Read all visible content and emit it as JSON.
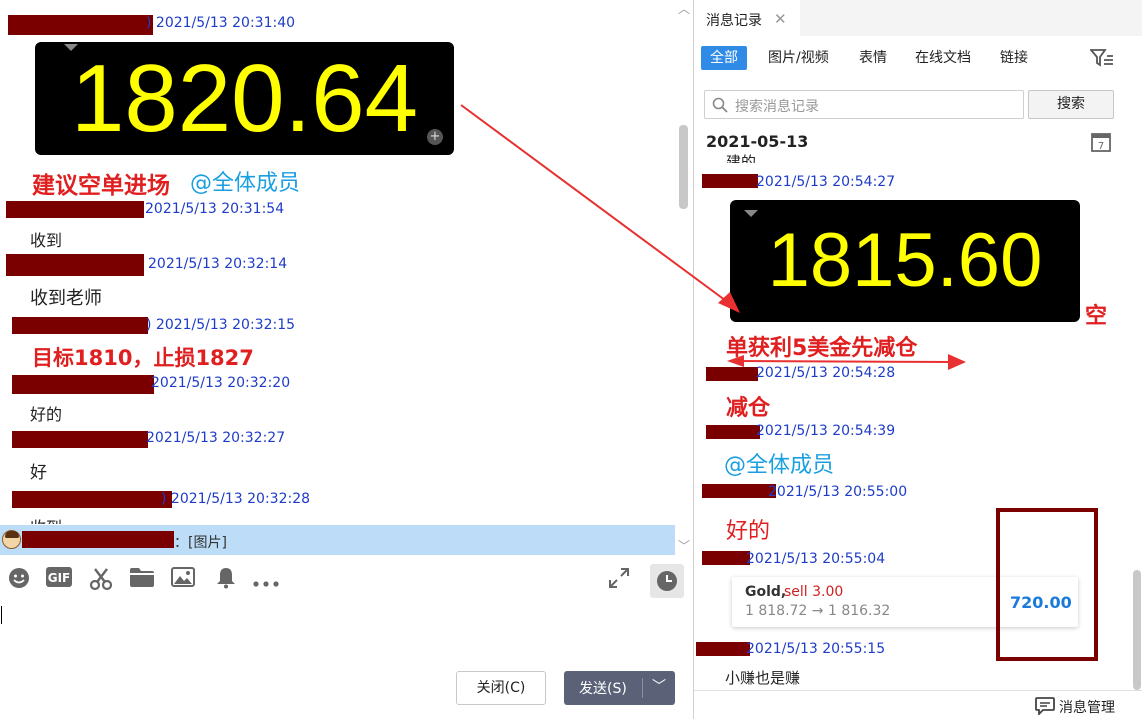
{
  "chat": {
    "messages": [
      {
        "timestamp": ") 2021/5/13 20:31:40",
        "price": "1820.64"
      },
      {
        "rich_red": "建议空单进场",
        "rich_at": "@全体成员"
      },
      {
        "timestamp": "2021/5/13 20:31:54",
        "text": "收到"
      },
      {
        "timestamp": "2021/5/13 20:32:14",
        "text": "收到老师"
      },
      {
        "timestamp": ") 2021/5/13 20:32:15",
        "rich_red": "目标1810，止损1827"
      },
      {
        "timestamp": "2021/5/13 20:32:20",
        "text": "好的"
      },
      {
        "timestamp": "2021/5/13 20:32:27",
        "text": "好"
      },
      {
        "timestamp": ") 2021/5/13 20:32:28",
        "text": "收到"
      }
    ],
    "latest_preview": "：[图片]"
  },
  "input": {
    "close_label": "关闭(C)",
    "send_label": "发送(S)"
  },
  "history": {
    "panel_title": "消息记录",
    "tabs": [
      "全部",
      "图片/视频",
      "表情",
      "在线文档",
      "链接"
    ],
    "active_tab": "全部",
    "search_placeholder": "搜索消息记录",
    "search_button": "搜索",
    "date": "2021-05-13",
    "cut_text": "建的",
    "entries": [
      {
        "timestamp": "2021/5/13 20:54:27",
        "price": "1815.60",
        "red_tail": "空",
        "red_line2": "单获利5美金先减仓"
      },
      {
        "timestamp": "2021/5/13 20:54:28",
        "red": "减仓"
      },
      {
        "timestamp": "2021/5/13 20:54:39",
        "at": "@全体成员"
      },
      {
        "timestamp": "2021/5/13 20:55:00",
        "red": "好的"
      },
      {
        "timestamp": "2021/5/13 20:55:04"
      },
      {
        "timestamp": "2021/5/13 20:55:15",
        "text": "小赚也是赚"
      }
    ],
    "trade_card": {
      "symbol": "Gold,",
      "action": "sell 3.00",
      "prices": "1 818.72 → 1 816.32",
      "profit": "720.00"
    },
    "manage_label": "消息管理"
  },
  "colors": {
    "timestamp": "#1e3cc8",
    "alert_red": "#e02020",
    "mention_blue": "#1a9fe0",
    "price_yellow": "#ffff00",
    "redaction": "#7a0000",
    "accent": "#2f8be6"
  },
  "icons": [
    "emoji-icon",
    "gif-icon",
    "scissors-icon",
    "folder-icon",
    "image-icon",
    "bell-icon",
    "more-icon",
    "expand-icon",
    "clock-icon",
    "filter-icon",
    "calendar-icon",
    "search-icon",
    "close-icon",
    "message-manage-icon"
  ]
}
